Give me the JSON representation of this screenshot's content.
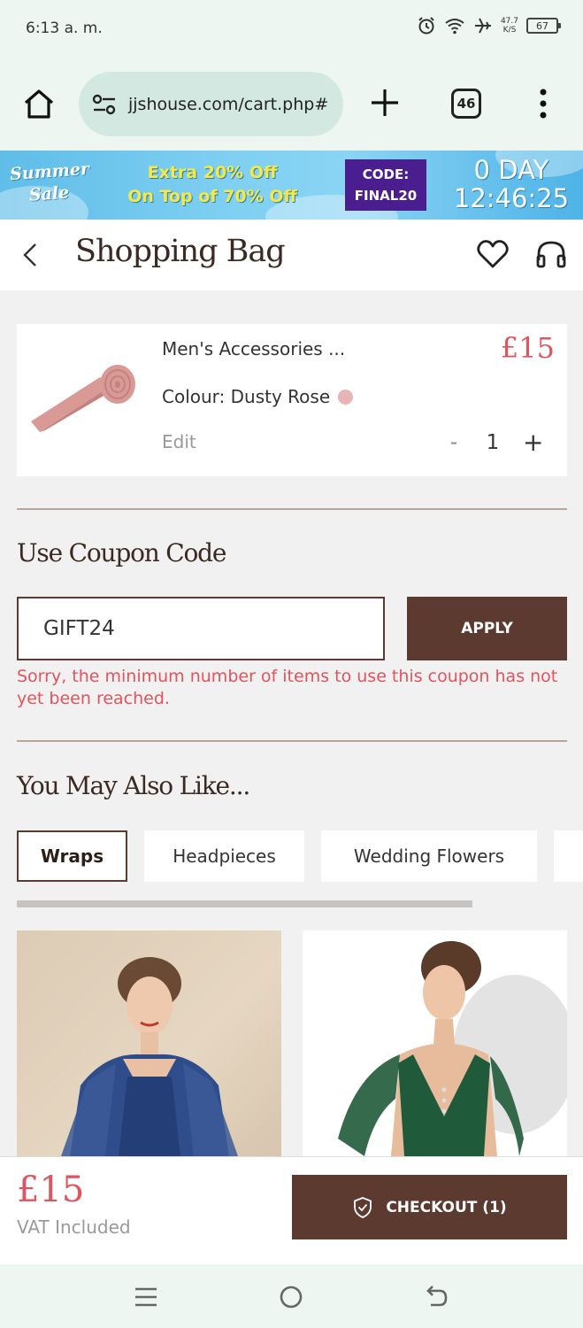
{
  "status_bar": {
    "time": "6:13 a. m.",
    "speed_value": "47.7",
    "speed_unit": "K/S",
    "battery": "67"
  },
  "browser": {
    "url": "jjshouse.com/cart.php#",
    "tab_count": "46"
  },
  "banner": {
    "summer_line1": "Summer",
    "summer_line2": "Sale",
    "offer_line1": "Extra 20% Off",
    "offer_line2": "On Top of 70% Off",
    "code_label": "CODE:",
    "code_value": "FINAL20",
    "countdown_days": "0 DAY",
    "countdown_time": "12:46:25"
  },
  "header": {
    "title": "Shopping Bag"
  },
  "cart_item": {
    "name": "Men's Accessories ...",
    "price": "£15",
    "colour": "Colour: Dusty Rose",
    "swatch_color": "#e8b4b8",
    "edit_label": "Edit",
    "qty_minus": "-",
    "qty_value": "1",
    "qty_plus": "+"
  },
  "coupon": {
    "title": "Use Coupon Code",
    "value": "GIFT24",
    "apply_label": "APPLY",
    "error": "Sorry, the minimum number of items to use this coupon has not yet been reached."
  },
  "recommendations": {
    "title": "You May Also Like...",
    "chips": [
      {
        "label": "Wraps",
        "active": true
      },
      {
        "label": "Headpieces",
        "active": false
      },
      {
        "label": "Wedding Flowers",
        "active": false
      }
    ]
  },
  "checkout": {
    "total": "£15",
    "vat": "VAT Included",
    "button_label": "CHECKOUT (1)"
  },
  "colors": {
    "accent": "#5d3a2f",
    "price": "#e0545e",
    "error": "#e0545e",
    "banner_code_bg": "#4b1e8f"
  }
}
